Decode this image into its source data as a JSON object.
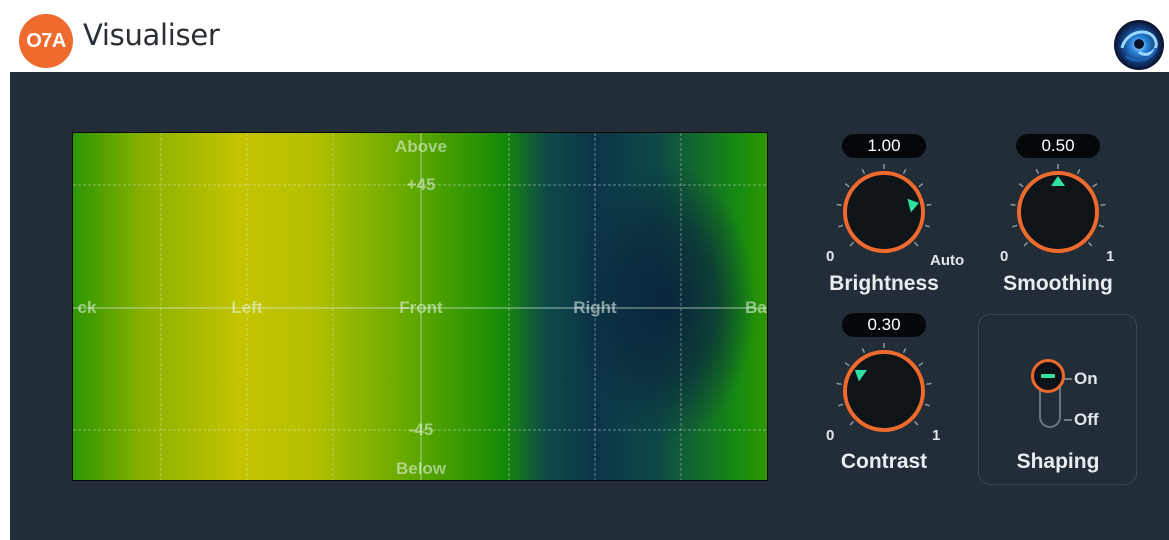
{
  "header": {
    "badge": "O7A",
    "title": "Visualiser"
  },
  "visualiser": {
    "labels": {
      "above": "Above",
      "plus45": "+45",
      "minus45": "-45",
      "below": "Below",
      "back_left": "ck",
      "left": "Left",
      "front": "Front",
      "right": "Right",
      "back_right": "Ba"
    }
  },
  "controls": {
    "brightness": {
      "label": "Brightness",
      "value": "1.00",
      "min_label": "0",
      "max_label": "Auto",
      "level": 0.78
    },
    "smoothing": {
      "label": "Smoothing",
      "value": "0.50",
      "min_label": "0",
      "max_label": "1",
      "level": 0.5
    },
    "contrast": {
      "label": "Contrast",
      "value": "0.30",
      "min_label": "0",
      "max_label": "1",
      "level": 0.3
    },
    "shaping": {
      "label": "Shaping",
      "on_label": "On",
      "off_label": "Off",
      "state": "On"
    }
  },
  "colors": {
    "accent": "#ef6a2d",
    "indicator": "#2fe0a0",
    "panel": "#232d37"
  }
}
